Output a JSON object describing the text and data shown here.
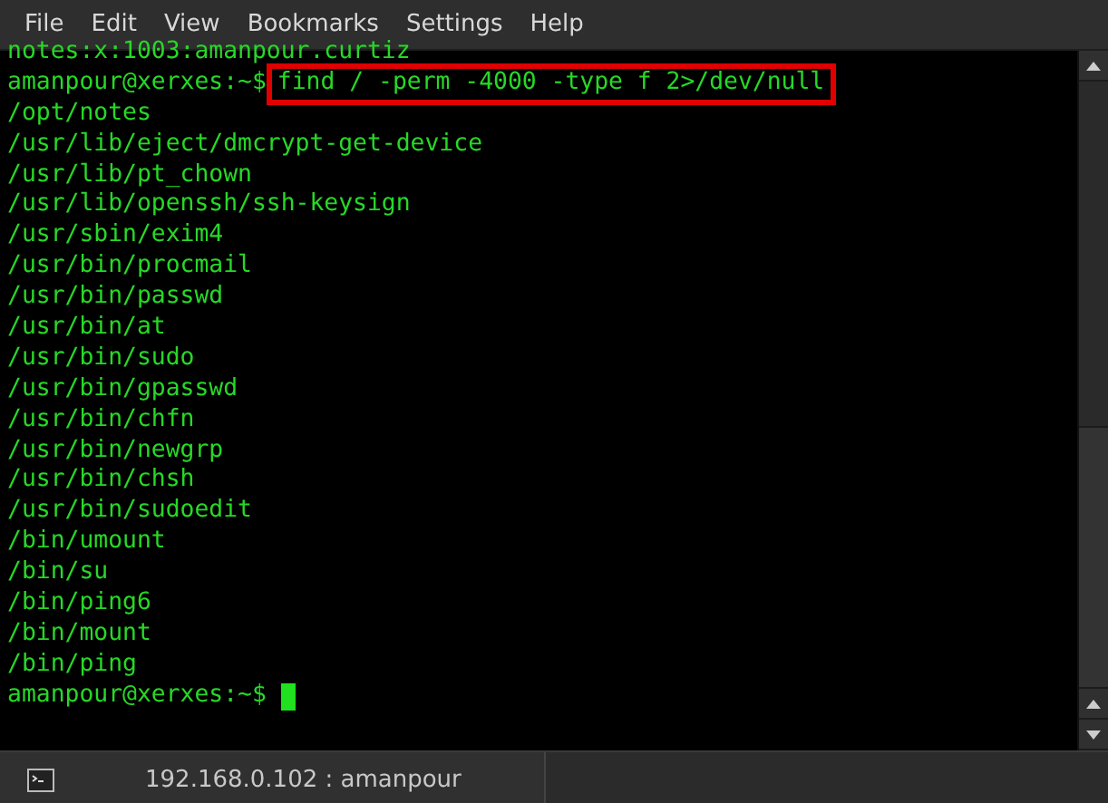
{
  "menu": [
    "File",
    "Edit",
    "View",
    "Bookmarks",
    "Settings",
    "Help"
  ],
  "lines": [
    {
      "kind": "output",
      "text": "notes:x:1003:amanpour.curtiz"
    },
    {
      "kind": "prompt",
      "prompt": "amanpour@xerxes:~$",
      "command": "find / -perm -4000 -type f 2>/dev/null",
      "highlighted": true
    },
    {
      "kind": "output",
      "text": "/opt/notes"
    },
    {
      "kind": "output",
      "text": "/usr/lib/eject/dmcrypt-get-device"
    },
    {
      "kind": "output",
      "text": "/usr/lib/pt_chown"
    },
    {
      "kind": "output",
      "text": "/usr/lib/openssh/ssh-keysign"
    },
    {
      "kind": "output",
      "text": "/usr/sbin/exim4"
    },
    {
      "kind": "output",
      "text": "/usr/bin/procmail"
    },
    {
      "kind": "output",
      "text": "/usr/bin/passwd"
    },
    {
      "kind": "output",
      "text": "/usr/bin/at"
    },
    {
      "kind": "output",
      "text": "/usr/bin/sudo"
    },
    {
      "kind": "output",
      "text": "/usr/bin/gpasswd"
    },
    {
      "kind": "output",
      "text": "/usr/bin/chfn"
    },
    {
      "kind": "output",
      "text": "/usr/bin/newgrp"
    },
    {
      "kind": "output",
      "text": "/usr/bin/chsh"
    },
    {
      "kind": "output",
      "text": "/usr/bin/sudoedit"
    },
    {
      "kind": "output",
      "text": "/bin/umount"
    },
    {
      "kind": "output",
      "text": "/bin/su"
    },
    {
      "kind": "output",
      "text": "/bin/ping6"
    },
    {
      "kind": "output",
      "text": "/bin/mount"
    },
    {
      "kind": "output",
      "text": "/bin/ping"
    },
    {
      "kind": "cursor",
      "prompt": "amanpour@xerxes:~$"
    }
  ],
  "tabs": [
    {
      "label": "192.168.0.102 : amanpour",
      "selected": true
    }
  ]
}
